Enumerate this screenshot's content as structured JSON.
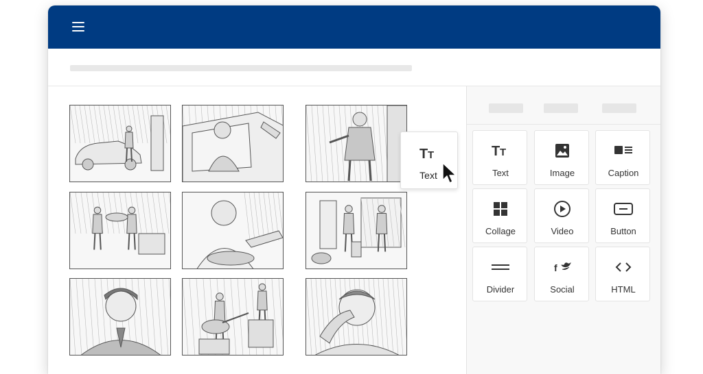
{
  "app": {
    "colors": {
      "topbar": "#003b82",
      "panel_bg": "#f8f8f8",
      "sketch": "#555555"
    },
    "menu_icon": "hamburger-menu-icon"
  },
  "storyboard": {
    "panels": [
      {
        "name": "storyboard-panel-car-street",
        "scene": "man beside car on street"
      },
      {
        "name": "storyboard-panel-driver",
        "scene": "man in car with hand at window"
      },
      {
        "name": "storyboard-panel-suit-man",
        "scene": "man in suit gesturing"
      },
      {
        "name": "storyboard-panel-couple-room",
        "scene": "man and woman holding tray"
      },
      {
        "name": "storyboard-panel-smiling-man",
        "scene": "smiling man receiving object"
      },
      {
        "name": "storyboard-panel-office",
        "scene": "two men in office"
      },
      {
        "name": "storyboard-panel-portrait",
        "scene": "man in suit portrait"
      },
      {
        "name": "storyboard-panel-musicians",
        "scene": "guitar and violin players"
      },
      {
        "name": "storyboard-panel-crying-man",
        "scene": "man wiping tears"
      }
    ]
  },
  "dragging": {
    "label": "Text",
    "icon": "text-icon"
  },
  "sidebar": {
    "tiles": [
      {
        "label": "Text",
        "icon": "text-icon"
      },
      {
        "label": "Image",
        "icon": "image-icon"
      },
      {
        "label": "Caption",
        "icon": "caption-icon"
      },
      {
        "label": "Collage",
        "icon": "collage-icon"
      },
      {
        "label": "Video",
        "icon": "video-play-icon"
      },
      {
        "label": "Button",
        "icon": "button-icon"
      },
      {
        "label": "Divider",
        "icon": "divider-icon"
      },
      {
        "label": "Social",
        "icon": "social-icon"
      },
      {
        "label": "HTML",
        "icon": "html-code-icon"
      }
    ]
  }
}
